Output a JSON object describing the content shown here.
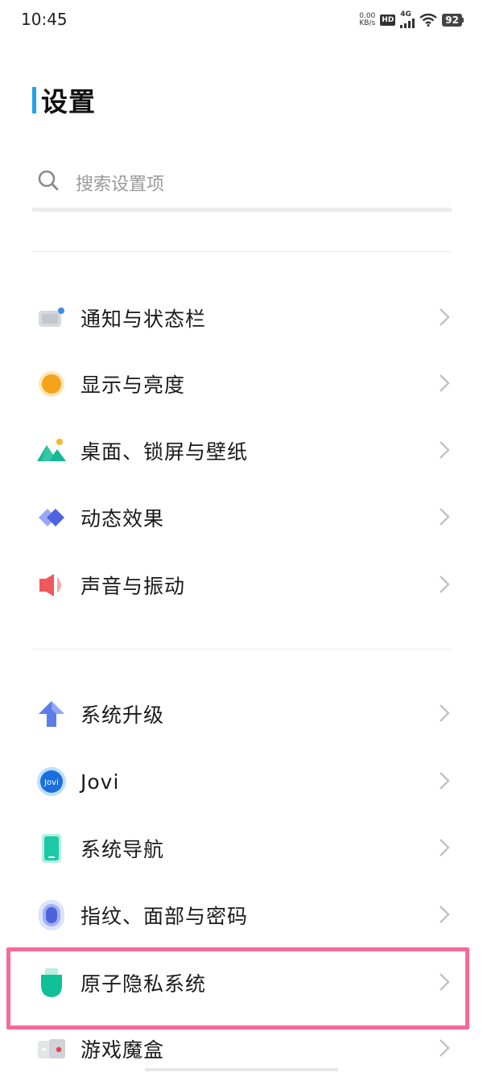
{
  "status_bar": {
    "time": "10:45",
    "net_speed_value": "0.00",
    "net_speed_unit": "KB/s",
    "hd_badge": "HD",
    "signal_type": "4G",
    "battery": "92"
  },
  "page": {
    "title": "设置"
  },
  "search": {
    "placeholder": "搜索设置项"
  },
  "menu": {
    "group1": [
      {
        "label": "通知与状态栏",
        "icon": "notification-statusbar-icon"
      },
      {
        "label": "显示与亮度",
        "icon": "display-brightness-icon"
      },
      {
        "label": "桌面、锁屏与壁纸",
        "icon": "wallpaper-icon"
      },
      {
        "label": "动态效果",
        "icon": "motion-effects-icon"
      },
      {
        "label": "声音与振动",
        "icon": "sound-vibration-icon"
      }
    ],
    "group2": [
      {
        "label": "系统升级",
        "icon": "system-update-icon"
      },
      {
        "label": "Jovi",
        "icon": "jovi-icon",
        "icon_text": "Jovi"
      },
      {
        "label": "系统导航",
        "icon": "system-navigation-icon"
      },
      {
        "label": "指纹、面部与密码",
        "icon": "fingerprint-icon"
      },
      {
        "label": "原子隐私系统",
        "icon": "privacy-shield-icon",
        "highlighted": true
      },
      {
        "label": "游戏魔盒",
        "icon": "game-box-icon"
      }
    ]
  },
  "colors": {
    "title_accent": "#1fa2e8",
    "highlight_border": "#f56a9a"
  }
}
